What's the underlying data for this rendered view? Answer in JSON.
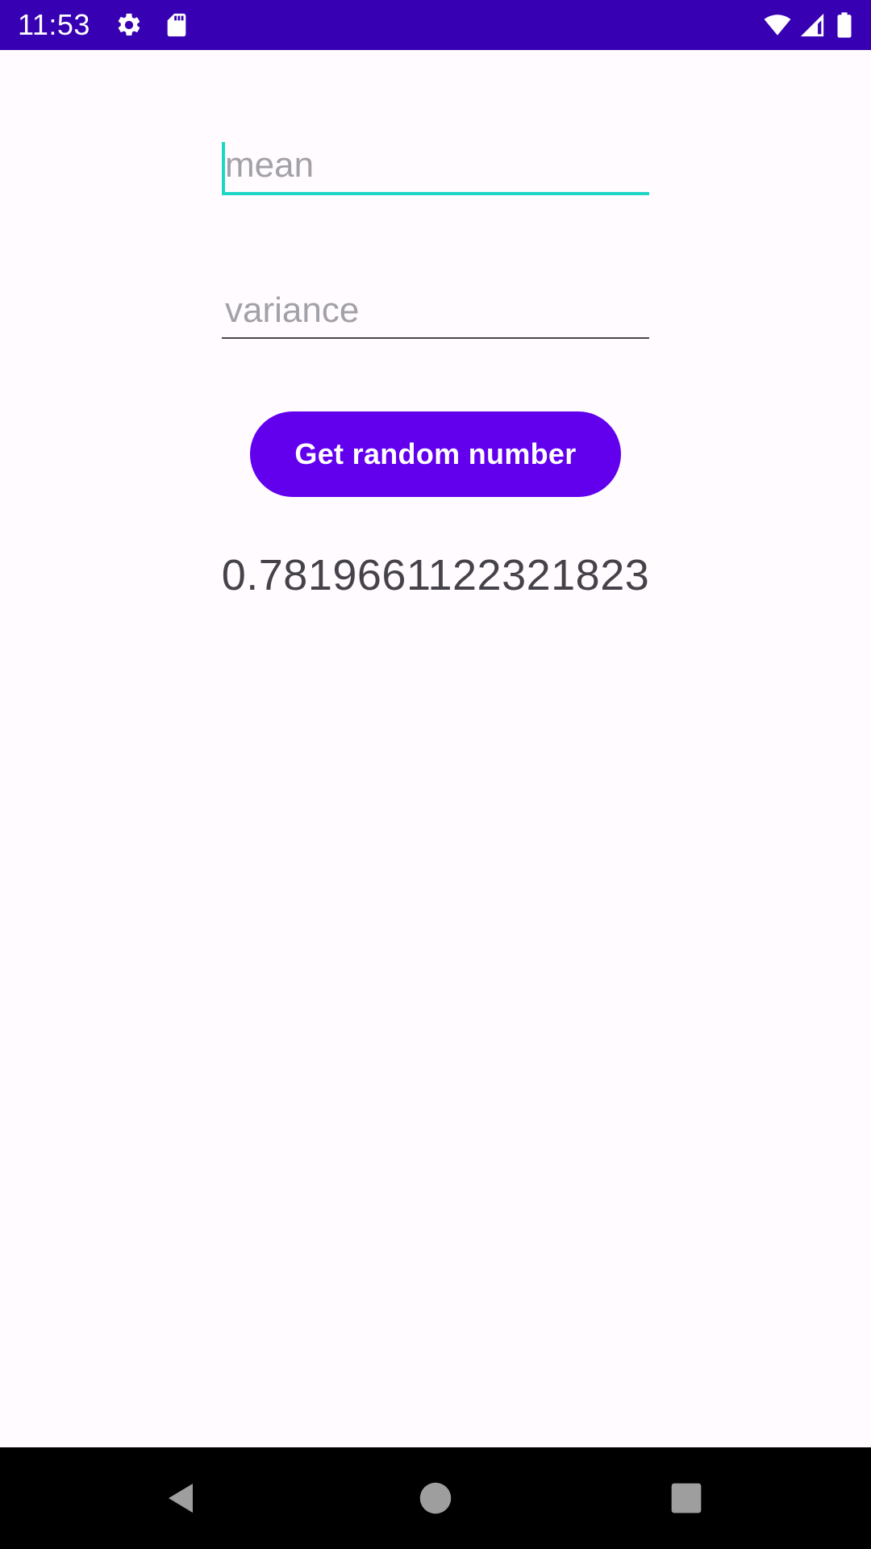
{
  "status_bar": {
    "time": "11:53",
    "icons": [
      "settings-icon",
      "sd-card-icon",
      "wifi-icon",
      "cell-signal-icon",
      "battery-icon"
    ],
    "background": "#3700B3"
  },
  "form": {
    "mean_field": {
      "placeholder": "mean",
      "value": ""
    },
    "variance_field": {
      "placeholder": "variance",
      "value": ""
    },
    "accent_color": "#1ED6C6"
  },
  "button": {
    "label": "Get random number",
    "color": "#6200EE"
  },
  "result": {
    "value": "0.7819661122321823"
  },
  "navigation_bar": {
    "buttons": [
      "back-icon",
      "home-icon",
      "recents-icon"
    ]
  }
}
